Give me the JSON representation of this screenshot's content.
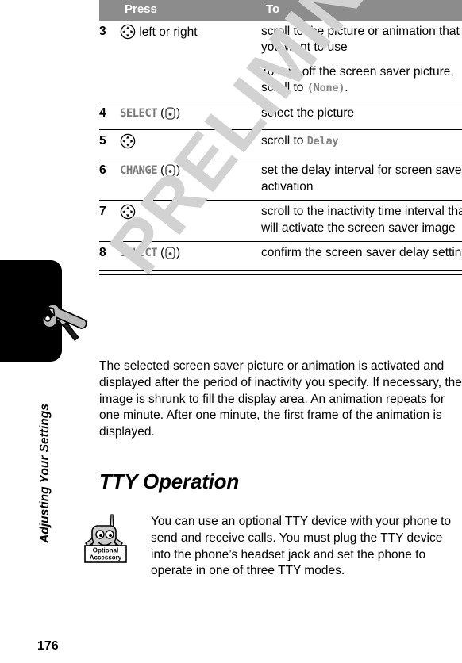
{
  "document": {
    "page_number": "176",
    "chapter_label": "Adjusting Your Settings",
    "watermark": "PRELIMINARY",
    "chapter_icon": "wrench-screwdriver-icon",
    "accessory_icon": "optional-accessory-icon",
    "accessory_icon_line1": "Optional",
    "accessory_icon_line2": "Accessory"
  },
  "table": {
    "headers": {
      "number": "",
      "press": "Press",
      "to": "To"
    },
    "rows": [
      {
        "number": "3",
        "press_icon": "navigation-key-icon",
        "press_text": "left or right",
        "to_lines": [
          {
            "text": "scroll to the picture or animation that you want to use"
          },
          {
            "prefix": "To turn off the screen saver picture, scroll to ",
            "mono": "(None)",
            "suffix": "."
          }
        ]
      },
      {
        "number": "4",
        "press_label": "SELECT",
        "press_icon": "soft-key-icon",
        "to_lines": [
          {
            "text": "select the picture"
          }
        ]
      },
      {
        "number": "5",
        "press_icon": "navigation-key-icon",
        "to_lines": [
          {
            "prefix": "scroll to ",
            "mono": "Delay",
            "suffix": ""
          }
        ]
      },
      {
        "number": "6",
        "press_label": "CHANGE",
        "press_icon": "soft-key-icon",
        "to_lines": [
          {
            "text": "set the delay interval for screen saver activation"
          }
        ]
      },
      {
        "number": "7",
        "press_icon": "navigation-key-icon",
        "to_lines": [
          {
            "text": "scroll to the inactivity time interval that will activate the screen saver image"
          }
        ]
      },
      {
        "number": "8",
        "press_label": "SELECT",
        "press_icon": "soft-key-icon",
        "to_lines": [
          {
            "text": "confirm the screen saver delay setting"
          }
        ]
      }
    ]
  },
  "body": {
    "intro_paragraph": "The selected screen saver picture or animation is activated and displayed after the period of inactivity you specify. If necessary, the image is shrunk to fill the display area. An animation repeats for one minute. After one minute, the first frame of the animation is displayed.",
    "section_title": "TTY Operation",
    "tty_paragraph": "You can use an optional TTY device with your phone to send and receive calls. You must plug the TTY device into the phone’s headset jack and set the phone to operate in one of three TTY modes."
  }
}
